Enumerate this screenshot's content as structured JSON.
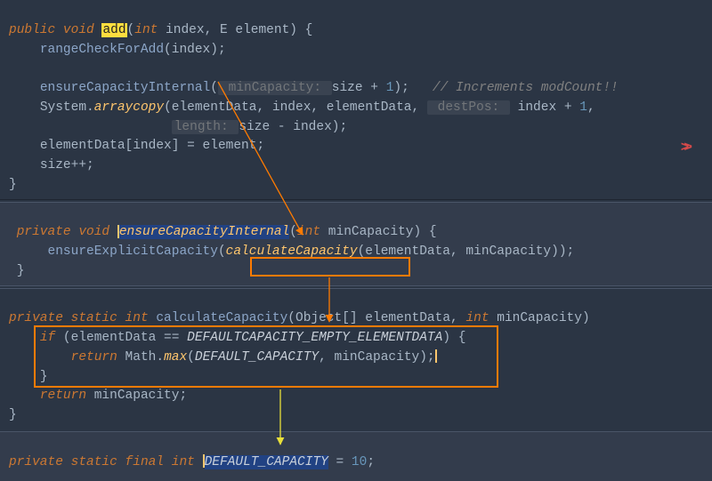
{
  "method1": {
    "sig_kw1": "public",
    "sig_kw2": "void",
    "name": "add",
    "sig_after": "(",
    "p1_type": "int",
    "p1_name": " index, E element) {",
    "line2_call": "rangeCheckForAdd",
    "line2_arg": "(index);",
    "line4_call": "ensureCapacityInternal",
    "line4_open": "(",
    "line4_hint": " minCapacity: ",
    "line4_rest": "size + ",
    "line4_num": "1",
    "line4_close": ");   ",
    "line4_comment": "// Increments modCount!!",
    "line5_pre": "System.",
    "line5_call": "arraycopy",
    "line5_args": "(elementData, index, elementData, ",
    "line5_hint": " destPos: ",
    "line5_rest": " index + ",
    "line5_num": "1",
    "line5_comma": ",",
    "line6_hint": "length: ",
    "line6_rest": "size - index);",
    "line7": "elementData[index] = element;",
    "line8": "size++;",
    "close": "}"
  },
  "method2": {
    "sig_kw1": "private",
    "sig_kw2": "void",
    "name": "ensureCapacityInternal",
    "sig_after": "(",
    "p1_type": "int",
    "p1_name": " minCapacity) {",
    "line2_call": "ensureExplicitCapacity",
    "line2_open": "(",
    "line2_inner": "calculateCapacity",
    "line2_args": "(elementData, minCapacity));",
    "close": "}"
  },
  "method3": {
    "sig_kw1": "private",
    "sig_kw2": "static",
    "sig_kw3": "int",
    "name": "calculateCapacity",
    "sig_after": "(Object[] elementData, ",
    "p2_type": "int",
    "p2_rest": " minCapacity) ",
    "line2_if": "if",
    "line2_open": " (elementData == ",
    "line2_const": "DEFAULTCAPACITY_EMPTY_ELEMENTDATA",
    "line2_close": ") {",
    "line3_ret": "return",
    "line3_rest1": " Math.",
    "line3_call": "max",
    "line3_rest2": "(",
    "line3_const": "DEFAULT_CAPACITY",
    "line3_rest3": ", minCapacity);",
    "line4": "}",
    "line5_ret": "return",
    "line5_rest": " minCapacity;",
    "close": "}"
  },
  "method4": {
    "sig_kw1": "private",
    "sig_kw2": "static",
    "sig_kw3": "final",
    "sig_kw4": "int",
    "name": "DEFAULT_CAPACITY",
    "rest": " = ",
    "num": "10",
    "semi": ";"
  }
}
